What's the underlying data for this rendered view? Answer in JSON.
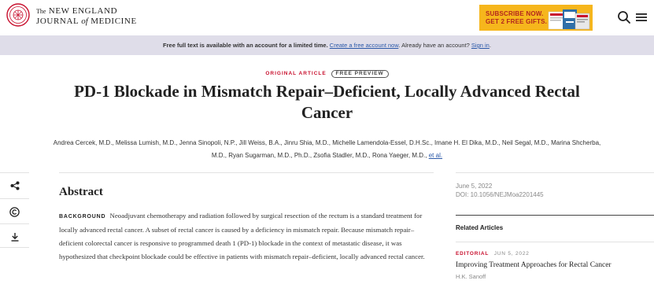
{
  "header": {
    "logo_the": "The",
    "logo_line1": "NEW ENGLAND",
    "logo_journal": "JOURNAL",
    "logo_of": "of",
    "logo_medicine": "MEDICINE",
    "promo_line1": "SUBSCRIBE NOW.",
    "promo_line2": "GET 2 FREE GIFTS. →",
    "search_icon": "search-icon",
    "menu_icon": "hamburger-menu-icon"
  },
  "notice": {
    "lead": "Free full text is available with an account for a limited time.",
    "create_link": "Create a free account now",
    "middle": ". Already have an account?",
    "signin_link": "Sign in",
    "end": "."
  },
  "article": {
    "type": "ORIGINAL ARTICLE",
    "badge": "FREE PREVIEW",
    "title": "PD-1 Blockade in Mismatch Repair–Deficient, Locally Advanced Rectal Cancer",
    "authors": "Andrea Cercek, M.D., Melissa Lumish, M.D., Jenna Sinopoli, N.P., Jill Weiss, B.A., Jinru Shia, M.D., Michelle Lamendola-Essel, D.H.Sc., Imane H. El Dika, M.D., Neil Segal, M.D., Marina Shcherba, M.D., Ryan Sugarman, M.D., Ph.D., Zsofia Stadler, M.D., Rona Yaeger, M.D.,",
    "et_al": "et al."
  },
  "rail": {
    "share_icon": "share-icon",
    "copyright_icon": "copyright-icon",
    "download_icon": "download-icon"
  },
  "abstract": {
    "heading": "Abstract",
    "background_label": "BACKGROUND",
    "background_text": "Neoadjuvant chemotherapy and radiation followed by surgical resection of the rectum is a standard treatment for locally advanced rectal cancer. A subset of rectal cancer is caused by a deficiency in mismatch repair. Because mismatch repair–deficient colorectal cancer is responsive to programmed death 1 (PD-1) blockade in the context of metastatic disease, it was hypothesized that checkpoint blockade could be effective in patients with mismatch repair–deficient, locally advanced rectal cancer."
  },
  "sidebar": {
    "date": "June 5, 2022",
    "doi": "DOI: 10.1056/NEJMoa2201445",
    "related_heading": "Related Articles",
    "related": [
      {
        "kind": "EDITORIAL",
        "date": "JUN 5, 2022",
        "title": "Improving Treatment Approaches for Rectal Cancer",
        "author": "H.K. Sanoff"
      }
    ]
  },
  "colors": {
    "accent_red": "#c8102e",
    "promo_yellow": "#f6b61c",
    "notice_bg": "#dfdde9",
    "link_blue": "#2a58a8"
  }
}
